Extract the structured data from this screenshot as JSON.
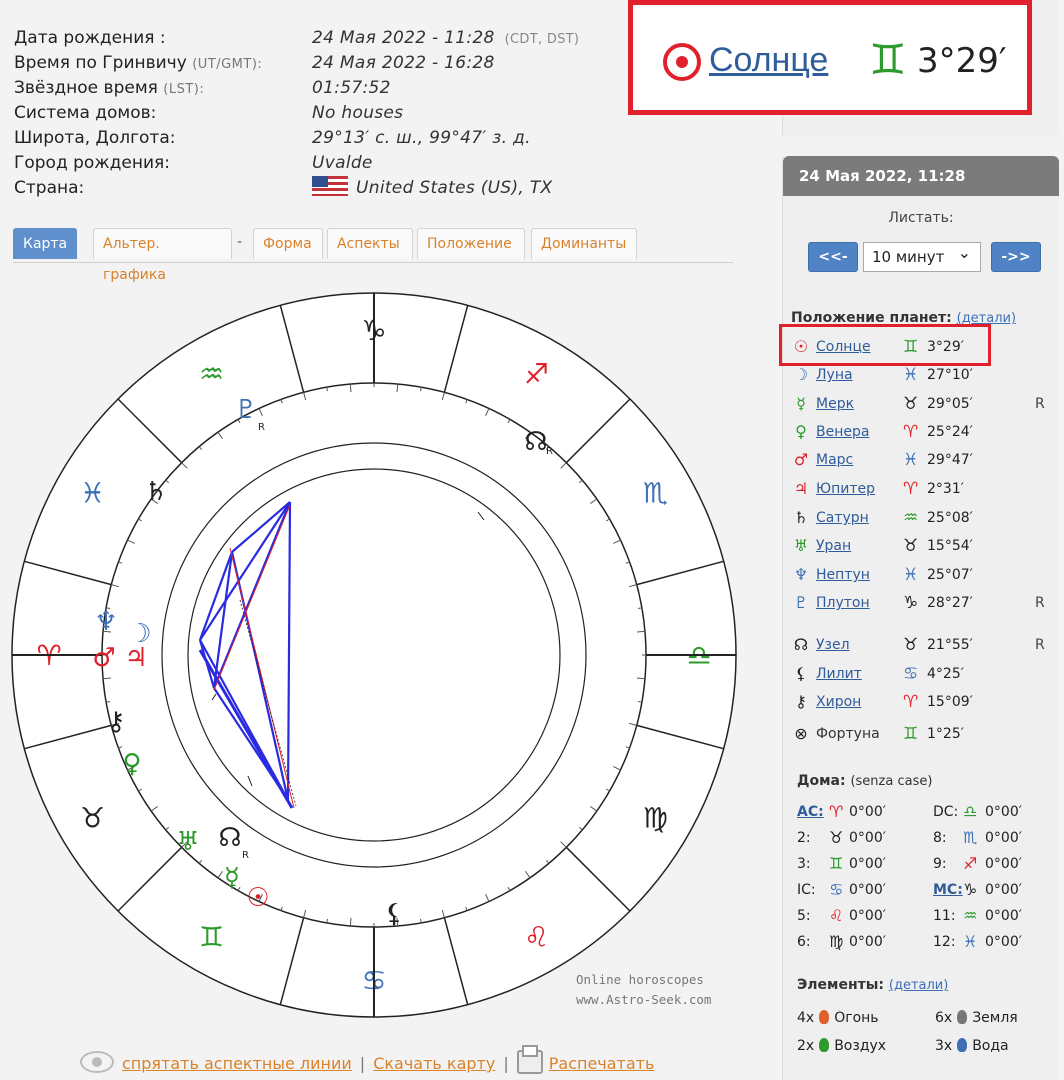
{
  "info": [
    {
      "label": "Дата рождения :",
      "label_sub": "",
      "value": "24 Мая 2022 - 11:28",
      "value_sub": "(CDT, DST)"
    },
    {
      "label": "Время по Гринвичу",
      "label_sub": "(UT/GMT):",
      "value": "24 Мая 2022 - 16:28",
      "value_sub": ""
    },
    {
      "label": "Звёздное время",
      "label_sub": "(LST):",
      "value": "01:57:52",
      "value_sub": ""
    },
    {
      "label": "Система домов:",
      "label_sub": "",
      "value": "No houses",
      "value_sub": ""
    },
    {
      "label": "Широта, Долгота:",
      "label_sub": "",
      "value": "29°13′ с. ш., 99°47′ з. д.",
      "value_sub": ""
    },
    {
      "label": "Город рождения:",
      "label_sub": "",
      "value": "Uvalde",
      "value_sub": ""
    },
    {
      "label": "Страна:",
      "label_sub": "",
      "value": "United States (US), TX",
      "value_sub": ""
    }
  ],
  "tabs": [
    "Карта",
    "Альтер. графика",
    "-",
    "Форма",
    "Аспекты",
    "Положение",
    "Доминанты"
  ],
  "active_tab": "Карта",
  "chart": {
    "zodiac_glyphs": [
      "♈",
      "♉",
      "♊",
      "♋",
      "♌",
      "♍",
      "♎",
      "♏",
      "♐",
      "♑",
      "♒",
      "♓"
    ],
    "planet_glyphs": [
      "☉",
      "☽",
      "☿",
      "♀",
      "♂",
      "♃",
      "♄",
      "♅",
      "♆",
      "♇",
      "☊",
      "⚸",
      "⚷"
    ],
    "retro_mark": "R",
    "zodiac_colors": [
      "#e0202a",
      "#222222",
      "#2c9a2c",
      "#3d6fb6"
    ],
    "brand_line1": "Online horoscopes",
    "brand_line2": "www.Astro-Seek.com"
  },
  "footer": {
    "hide_lines": "спрятать аспектные линии",
    "download": "Скачать карту",
    "print": "Распечатать"
  },
  "side": {
    "header": "24 Мая 2022, 11:28",
    "scroll_label": "Листать:",
    "prev": "<<-",
    "next": "->>",
    "step": "10 минут",
    "planets_title": "Положение планет:",
    "planets_link": "(детали)",
    "planets": [
      {
        "glyph": "☉",
        "name": "Солнце",
        "sign": "♊",
        "deg": "3°29′",
        "r": "",
        "gcolor": "#e0202a",
        "scolor": "#2c9a2c",
        "link": true
      },
      {
        "glyph": "☽",
        "name": "Луна",
        "sign": "♓",
        "deg": "27°10′",
        "r": "",
        "gcolor": "#3d6fb6",
        "scolor": "#3d6fb6",
        "link": true
      },
      {
        "glyph": "☿",
        "name": "Мерк",
        "sign": "♉",
        "deg": "29°05′",
        "r": "R",
        "gcolor": "#2c9a2c",
        "scolor": "#222222",
        "link": true
      },
      {
        "glyph": "♀",
        "name": "Венера",
        "sign": "♈",
        "deg": "25°24′",
        "r": "",
        "gcolor": "#2c9a2c",
        "scolor": "#e0202a",
        "link": true
      },
      {
        "glyph": "♂",
        "name": "Марс",
        "sign": "♓",
        "deg": "29°47′",
        "r": "",
        "gcolor": "#e0202a",
        "scolor": "#3d6fb6",
        "link": true
      },
      {
        "glyph": "♃",
        "name": "Юпитер",
        "sign": "♈",
        "deg": "2°31′",
        "r": "",
        "gcolor": "#e0202a",
        "scolor": "#e0202a",
        "link": true
      },
      {
        "glyph": "♄",
        "name": "Сатурн",
        "sign": "♒",
        "deg": "25°08′",
        "r": "",
        "gcolor": "#222222",
        "scolor": "#2c9a2c",
        "link": true
      },
      {
        "glyph": "♅",
        "name": "Уран",
        "sign": "♉",
        "deg": "15°54′",
        "r": "",
        "gcolor": "#2c9a2c",
        "scolor": "#222222",
        "link": true
      },
      {
        "glyph": "♆",
        "name": "Нептун",
        "sign": "♓",
        "deg": "25°07′",
        "r": "",
        "gcolor": "#3d6fb6",
        "scolor": "#3d6fb6",
        "link": true
      },
      {
        "glyph": "♇",
        "name": "Плутон",
        "sign": "♑",
        "deg": "28°27′",
        "r": "R",
        "gcolor": "#3d6fb6",
        "scolor": "#222222",
        "link": true
      },
      {
        "glyph": "☊",
        "name": "Узел",
        "sign": "♉",
        "deg": "21°55′",
        "r": "R",
        "gcolor": "#222222",
        "scolor": "#222222",
        "link": true
      },
      {
        "glyph": "⚸",
        "name": "Лилит",
        "sign": "♋",
        "deg": "4°25′",
        "r": "",
        "gcolor": "#222222",
        "scolor": "#3d6fb6",
        "link": true
      },
      {
        "glyph": "⚷",
        "name": "Хирон",
        "sign": "♈",
        "deg": "15°09′",
        "r": "",
        "gcolor": "#222222",
        "scolor": "#e0202a",
        "link": true
      },
      {
        "glyph": "⊗",
        "name": "Фортуна",
        "sign": "♊",
        "deg": "1°25′",
        "r": "",
        "gcolor": "#222222",
        "scolor": "#2c9a2c",
        "link": false
      }
    ],
    "houses_title": "Дома:",
    "houses_sub": "(senza case)",
    "houses": [
      {
        "n": "AC:",
        "z": "♈",
        "d": "0°00′",
        "u": true,
        "zc": "#e0202a"
      },
      {
        "n": "DC:",
        "z": "♎",
        "d": "0°00′",
        "u": false,
        "zc": "#2c9a2c"
      },
      {
        "n": "2:",
        "z": "♉",
        "d": "0°00′",
        "u": false,
        "zc": "#222222"
      },
      {
        "n": "8:",
        "z": "♏",
        "d": "0°00′",
        "u": false,
        "zc": "#3d6fb6"
      },
      {
        "n": "3:",
        "z": "♊",
        "d": "0°00′",
        "u": false,
        "zc": "#2c9a2c"
      },
      {
        "n": "9:",
        "z": "♐",
        "d": "0°00′",
        "u": false,
        "zc": "#e0202a"
      },
      {
        "n": "IC:",
        "z": "♋",
        "d": "0°00′",
        "u": false,
        "zc": "#3d6fb6"
      },
      {
        "n": "MC:",
        "z": "♑",
        "d": "0°00′",
        "u": true,
        "zc": "#222222"
      },
      {
        "n": "5:",
        "z": "♌",
        "d": "0°00′",
        "u": false,
        "zc": "#e0202a"
      },
      {
        "n": "11:",
        "z": "♒",
        "d": "0°00′",
        "u": false,
        "zc": "#2c9a2c"
      },
      {
        "n": "6:",
        "z": "♍",
        "d": "0°00′",
        "u": false,
        "zc": "#222222"
      },
      {
        "n": "12:",
        "z": "♓",
        "d": "0°00′",
        "u": false,
        "zc": "#3d6fb6"
      }
    ],
    "elements_title": "Элементы:",
    "elements_link": "(детали)",
    "elements": [
      {
        "count": "4x",
        "name": "Огонь",
        "color": "#e0602a"
      },
      {
        "count": "6x",
        "name": "Земля",
        "color": "#777777"
      },
      {
        "count": "2x",
        "name": "Воздух",
        "color": "#2c9a2c"
      },
      {
        "count": "3x",
        "name": "Вода",
        "color": "#3d6fb6"
      }
    ]
  },
  "zoom": {
    "glyph": "☉",
    "name": "Солнце",
    "sign": "♊",
    "deg": "3°29′"
  }
}
